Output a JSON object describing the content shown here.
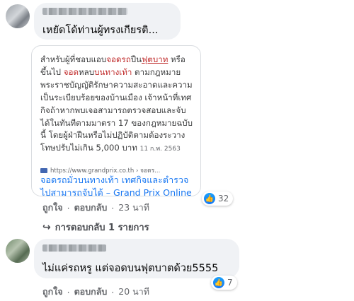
{
  "comment1": {
    "text": "เหยัดโด้ท่านผู้ทรงเกียรติ...",
    "link_card": {
      "quote_parts": [
        {
          "t": "สำหรับผู้ที่ชอบแอบ",
          "s": ""
        },
        {
          "t": "จอดรถ",
          "s": "hl"
        },
        {
          "t": "ปืน",
          "s": ""
        },
        {
          "t": "ฟุตบาท",
          "s": "hl2"
        },
        {
          "t": " หรือขึ้นไป ",
          "s": ""
        },
        {
          "t": "จอด",
          "s": "hl"
        },
        {
          "t": "หลบ",
          "s": ""
        },
        {
          "t": "บนทางเท้า",
          "s": "hl"
        },
        {
          "t": " ตามกฎหมายพระราชบัญญัติรักษาความสะอาดและความเป็นระเบียบร้อยของบ้านเมือง เจ้าหน้าที่เทศกิจถ้าหากพบเจอสามารถตรวจสอบและจับได้ในทันทีตามมาตรา 17 ของกฎหมายฉบับนี้ โดยผู้ฝ่าฝืนหรือไม่ปฏิบัติตามต้องระวางโทษปรับไม่เกิน 5,000 บาท ",
          "s": ""
        }
      ],
      "date": "11 ก.พ. 2563",
      "source_url": "https://www.grandprix.co.th › จอดร...",
      "title": "จอดรถมั่วบนทางเท้า เทศกิจและตำรวจไปสามารถจับได้ – Grand Prix Online"
    },
    "reaction_count": "32",
    "actions": {
      "like": "ถูกใจ",
      "reply": "ตอบกลับ",
      "separator": "·",
      "time": "23 นาที"
    },
    "replies_label": "การตอบกลับ 1 รายการ"
  },
  "comment2": {
    "text": "ไม่แค่รถหรู แต่จอดบนฟุตบาตด้วย5555",
    "reaction_count": "7",
    "actions": {
      "like": "ถูกใจ",
      "reply": "ตอบกลับ",
      "separator": "·",
      "time": "20 นาที"
    }
  },
  "icons": {
    "like": "like-thumb-icon",
    "reply_arrow": "reply-arrow-icon"
  },
  "colors": {
    "link": "#1877f2",
    "highlight": "#c02b2b",
    "bubble": "#f0f2f5",
    "meta": "#65676b"
  }
}
